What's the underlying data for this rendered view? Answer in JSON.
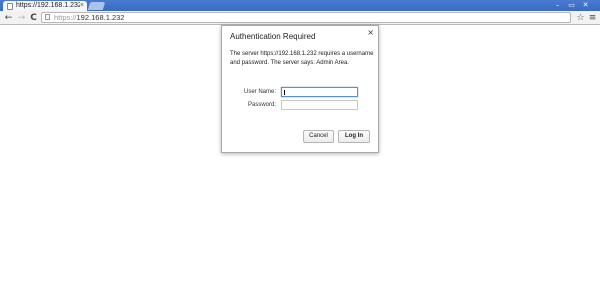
{
  "browser": {
    "tab": {
      "title": "https://192.168.1.232",
      "close": "×",
      "favicon": "page-icon"
    },
    "window_controls": {
      "minimize": "–",
      "restore": "▭",
      "close": "✕"
    },
    "toolbar": {
      "back": "←",
      "forward": "→",
      "reload": "C",
      "address": {
        "scheme": "https://",
        "host": "192.168.1.232"
      },
      "star": "☆",
      "menu": "≡"
    }
  },
  "dialog": {
    "title": "Authentication Required",
    "close": "×",
    "message": "The server https://192.168.1.232 requires a username and password. The server says: Admin Area.",
    "username_label": "User Name:",
    "username_value": "",
    "password_label": "Password:",
    "password_value": "",
    "cancel_label": "Cancel",
    "login_label": "Log In"
  }
}
